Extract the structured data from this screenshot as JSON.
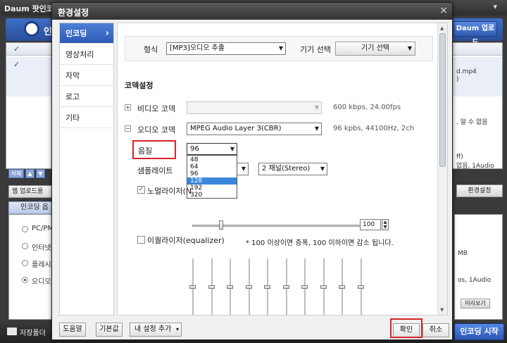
{
  "background_app": {
    "title": "Daum 팟인코더",
    "header_logo_text": "인코",
    "upload_button": "Daum 업로드",
    "right_texts": [
      "d.mp4",
      ")",
      ", 알 수 없음",
      "ff)",
      "없음, 1Audio"
    ],
    "toolbar_delete": "삭제",
    "web_upload": "웹 업로드용",
    "encode_options": "인코딩 옵션",
    "env_settings": "환경설정",
    "radio_options": [
      "PC/PM",
      "인터넷",
      "플레시",
      "오디오"
    ],
    "right_panel_texts": [
      "MB",
      "os, 1Audio"
    ],
    "preview_button": "미리보기",
    "save_folder": "저장폴더",
    "start_button": "인코딩 시작"
  },
  "dialog": {
    "title": "환경설정",
    "nav": [
      {
        "label": "인코딩",
        "active": true
      },
      {
        "label": "영상처리",
        "active": false
      },
      {
        "label": "자막",
        "active": false
      },
      {
        "label": "로고",
        "active": false
      },
      {
        "label": "기타",
        "active": false
      }
    ],
    "format": {
      "label": "형식",
      "value": "[MP3]오디오 추출",
      "device_label": "기기 선택",
      "device_value": "기기 선택"
    },
    "codec_section_title": "코덱설정",
    "video_codec": {
      "label": "비디오 코덱",
      "value": "",
      "info": "600 kbps, 24.00fps"
    },
    "audio_codec": {
      "label": "오디오 코덱",
      "value": "MPEG Audio Layer 3(CBR)",
      "info": "96 kpbs, 44100Hz, 2ch"
    },
    "quality": {
      "label": "음질",
      "value": "96",
      "options": [
        "48",
        "64",
        "96",
        "128",
        "192",
        "320"
      ],
      "highlighted": "128"
    },
    "sample_rate": {
      "label": "샘플레이트",
      "channel_value": "2 채널(Stereo)"
    },
    "normalizer": {
      "label": "노멀라이저(N",
      "checked": true,
      "value": "100",
      "level_fraction": 0.17,
      "note": "* 100 이상이면 증폭, 100 이하이면 감소 됩니다."
    },
    "equalizer": {
      "label": "이퀄라이저(equalizer)",
      "checked": false,
      "bands": 10
    },
    "footer": {
      "help": "도움말",
      "default": "기본값",
      "my_settings": "내 설정 추가",
      "ok": "확인",
      "cancel": "취소"
    },
    "highlight_color": "#d8232a",
    "accent_color": "#3a86d9"
  }
}
